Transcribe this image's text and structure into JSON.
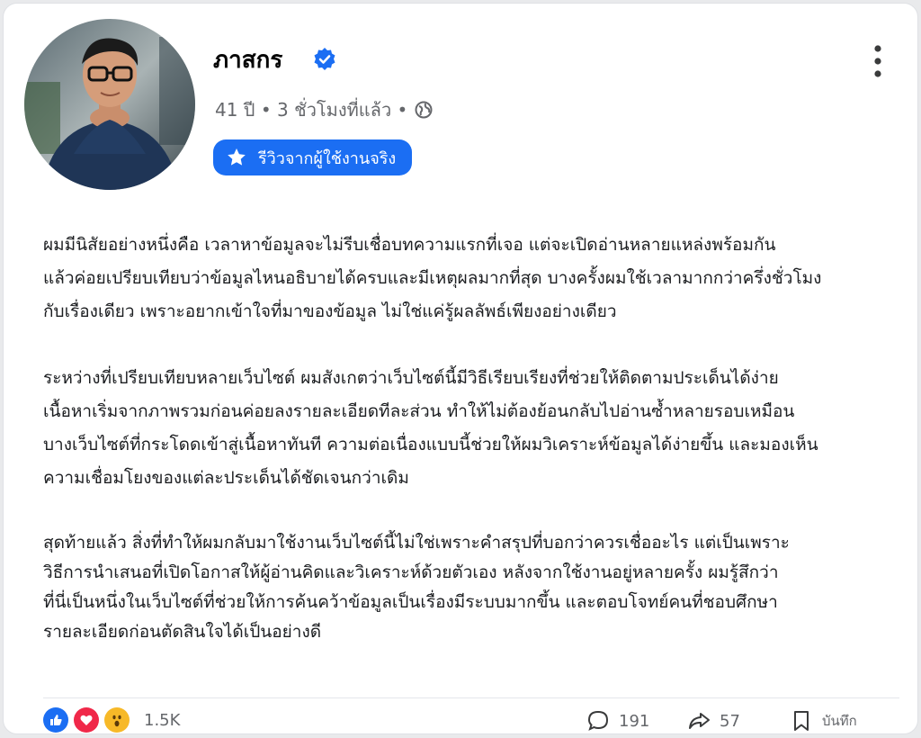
{
  "post": {
    "author_name": "ภาสกร",
    "meta_age": "41 ปี",
    "meta_time": "3 ชั่วโมงที่แล้ว",
    "badge_label": "รีวิวจากผู้ใช้งานจริง",
    "verified_icon": "verified-check-icon",
    "privacy_icon": "globe-icon",
    "paragraphs": [
      "ผมมีนิสัยอย่างหนึ่งคือ เวลาหาข้อมูลจะไม่รีบเชื่อบทความแรกที่เจอ แต่จะเปิดอ่านหลายแหล่งพร้อมกัน\nแล้วค่อยเปรียบเทียบว่าข้อมูลไหนอธิบายได้ครบและมีเหตุผลมากที่สุด บางครั้งผมใช้เวลามากกว่าครึ่งชั่วโมง\nกับเรื่องเดียว เพราะอยากเข้าใจที่มาของข้อมูล ไม่ใช่แค่รู้ผลลัพธ์เพียงอย่างเดียว",
      "ระหว่างที่เปรียบเทียบหลายเว็บไซต์ ผมสังเกตว่าเว็บไซต์นี้มีวิธีเรียบเรียงที่ช่วยให้ติดตามประเด็นได้ง่าย\nเนื้อหาเริ่มจากภาพรวมก่อนค่อยลงรายละเอียดทีละส่วน ทำให้ไม่ต้องย้อนกลับไปอ่านซ้ำหลายรอบเหมือน\nบางเว็บไซต์ที่กระโดดเข้าสู่เนื้อหาทันที ความต่อเนื่องแบบนี้ช่วยให้ผมวิเคราะห์ข้อมูลได้ง่ายขึ้น และมองเห็น\nความเชื่อมโยงของแต่ละประเด็นได้ชัดเจนกว่าเดิม",
      "สุดท้ายแล้ว สิ่งที่ทำให้ผมกลับมาใช้งานเว็บไซต์นี้ไม่ใช่เพราะคำสรุปที่บอกว่าควรเชื่ออะไร แต่เป็นเพราะ\nวิธีการนำเสนอที่เปิดโอกาสให้ผู้อ่านคิดและวิเคราะห์ด้วยตัวเอง หลังจากใช้งานอยู่หลายครั้ง ผมรู้สึกว่า\nที่นี่เป็นหนึ่งในเว็บไซต์ที่ช่วยให้การค้นคว้าข้อมูลเป็นเรื่องมีระบบมากขึ้น และตอบโจทย์คนที่ชอบศึกษา\nรายละเอียดก่อนตัดสินใจได้เป็นอย่างดี"
    ]
  },
  "footer": {
    "reactions": [
      "like-icon",
      "love-icon",
      "wow-icon"
    ],
    "reaction_count": "1.5K",
    "comment_count": "191",
    "share_count": "57",
    "save_label": "บันทึก"
  },
  "colors": {
    "accent": "#1b6ef3",
    "text": "#1c1e21",
    "muted": "#65676b"
  }
}
